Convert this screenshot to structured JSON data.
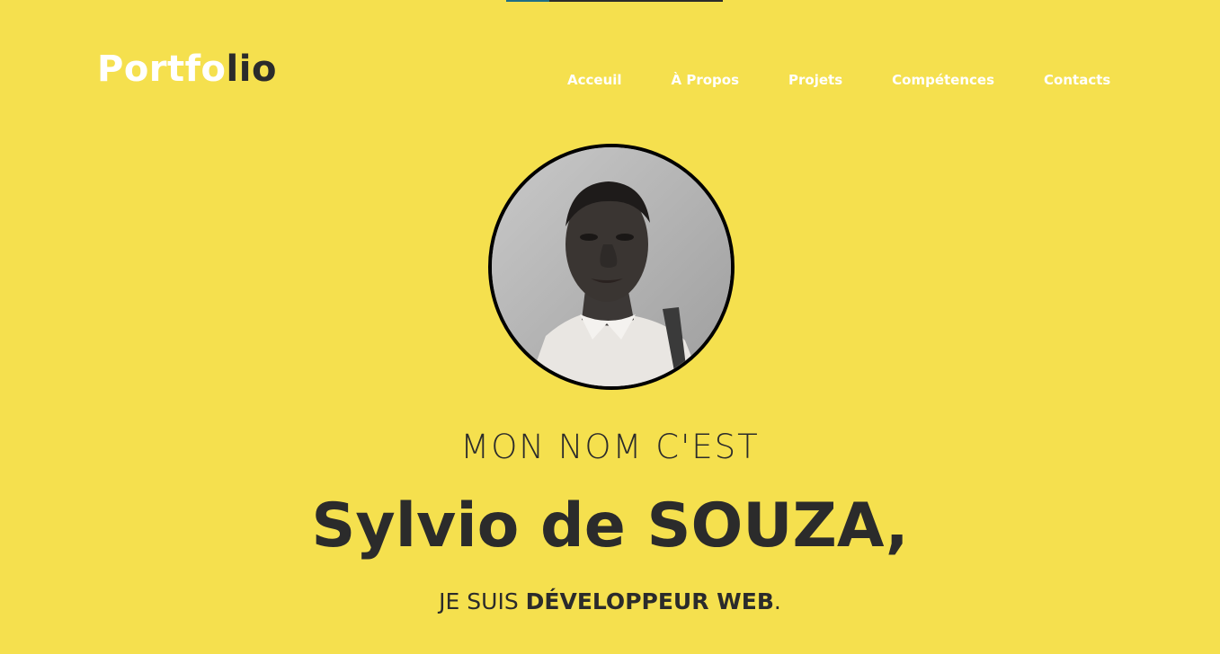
{
  "scroll_progress": 0.2,
  "header": {
    "logo_part1": "Portfo",
    "logo_part2": "lio",
    "nav": [
      {
        "label": "Acceuil"
      },
      {
        "label": "À Propos"
      },
      {
        "label": "Projets"
      },
      {
        "label": "Compétences"
      },
      {
        "label": "Contacts"
      }
    ]
  },
  "hero": {
    "intro": "MON NOM C'EST",
    "name": "Sylvio de SOUZA,",
    "role_prefix": "JE SUIS ",
    "role_strong": "DÉVELOPPEUR WEB",
    "role_suffix": "."
  },
  "colors": {
    "background": "#f5e04e",
    "text": "#2b2b2b",
    "logo_accent": "#ffffff",
    "progress_fill": "#1f6f86"
  }
}
